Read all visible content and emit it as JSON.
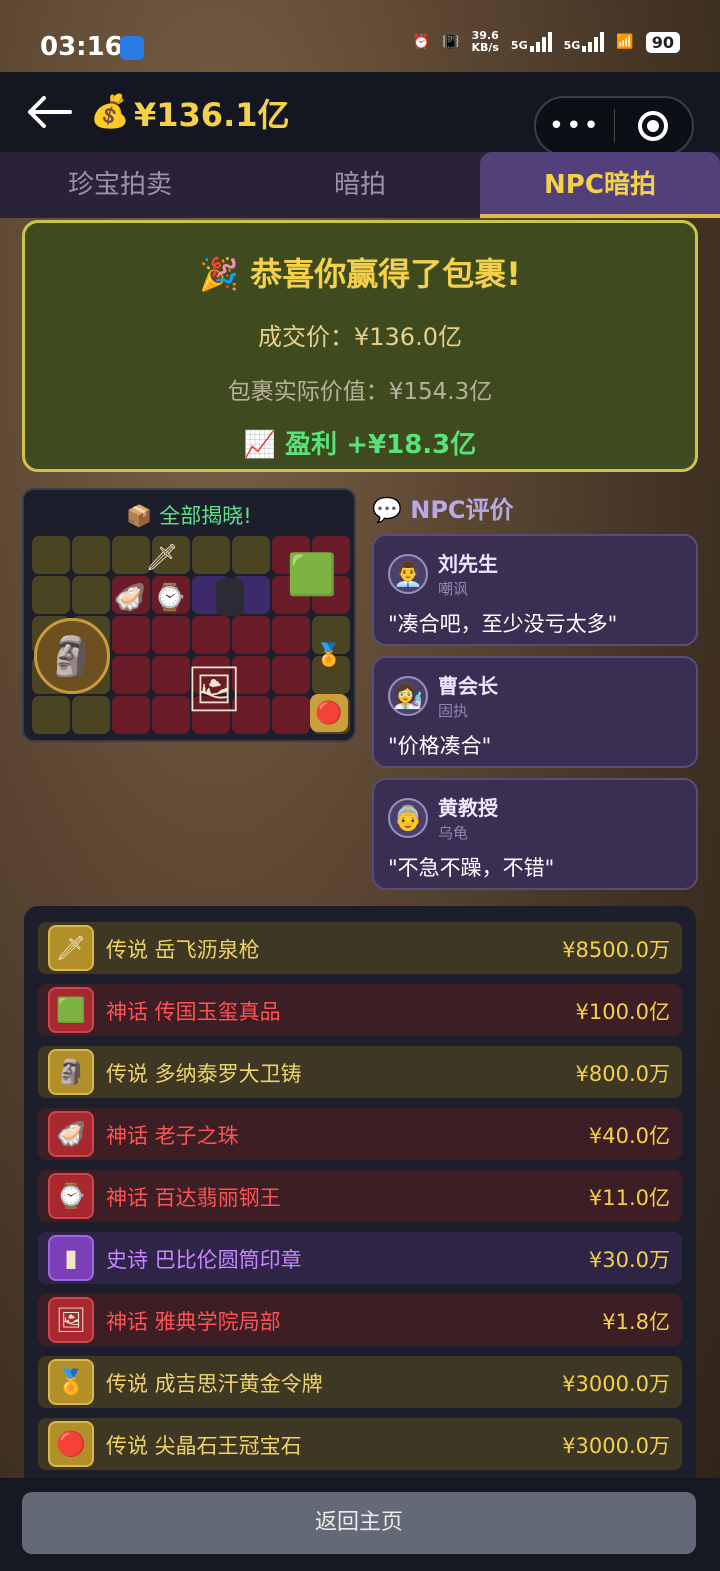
{
  "status": {
    "time": "03:16",
    "net_speed": "39.6",
    "net_unit": "KB/s",
    "sig1": "5G",
    "sig2": "5G",
    "battery": "90"
  },
  "header": {
    "balance": "¥136.1亿",
    "money_icon": "💰"
  },
  "tabs": [
    {
      "label": "珍宝拍卖"
    },
    {
      "label": "暗拍"
    },
    {
      "label": "NPC暗拍"
    }
  ],
  "result": {
    "icon": "🎉",
    "title": "恭喜你赢得了包裹!",
    "price": "成交价：¥136.0亿",
    "value": "包裹实际价值：¥154.3亿",
    "profit_icon": "📈",
    "profit": "盈利 +¥18.3亿"
  },
  "reveal": {
    "icon": "📦",
    "title": "全部揭晓!"
  },
  "npc": {
    "icon": "💬",
    "heading": "NPC评价",
    "comments": [
      {
        "avatar": "👨‍💼",
        "name": "刘先生",
        "trait": "嘲讽",
        "quote": "\"凑合吧，至少没亏太多\""
      },
      {
        "avatar": "👩‍🔬",
        "name": "曹会长",
        "trait": "固执",
        "quote": "\"价格凑合\""
      },
      {
        "avatar": "👵",
        "name": "黄教授",
        "trait": "乌龟",
        "quote": "\"不急不躁，不错\""
      }
    ]
  },
  "items": [
    {
      "rarity": "legend",
      "text": "传说 岳飞沥泉枪",
      "price": "¥8500.0万",
      "icon": "🗡"
    },
    {
      "rarity": "myth",
      "text": "神话 传国玉玺真品",
      "price": "¥100.0亿",
      "icon": "🟩"
    },
    {
      "rarity": "legend",
      "text": "传说 多纳泰罗大卫铸",
      "price": "¥800.0万",
      "icon": "🗿"
    },
    {
      "rarity": "myth",
      "text": "神话 老子之珠",
      "price": "¥40.0亿",
      "icon": "🦪"
    },
    {
      "rarity": "myth",
      "text": "神话 百达翡丽钢王",
      "price": "¥11.0亿",
      "icon": "⌚"
    },
    {
      "rarity": "epic",
      "text": "史诗 巴比伦圆筒印章",
      "price": "¥30.0万",
      "icon": "▮"
    },
    {
      "rarity": "myth",
      "text": "神话 雅典学院局部",
      "price": "¥1.8亿",
      "icon": "🖼"
    },
    {
      "rarity": "legend",
      "text": "传说 成吉思汗黄金令牌",
      "price": "¥3000.0万",
      "icon": "🏅"
    },
    {
      "rarity": "legend",
      "text": "传说 尖晶石王冠宝石",
      "price": "¥3000.0万",
      "icon": "🔴"
    }
  ],
  "footer": {
    "home_label": "返回主页"
  }
}
